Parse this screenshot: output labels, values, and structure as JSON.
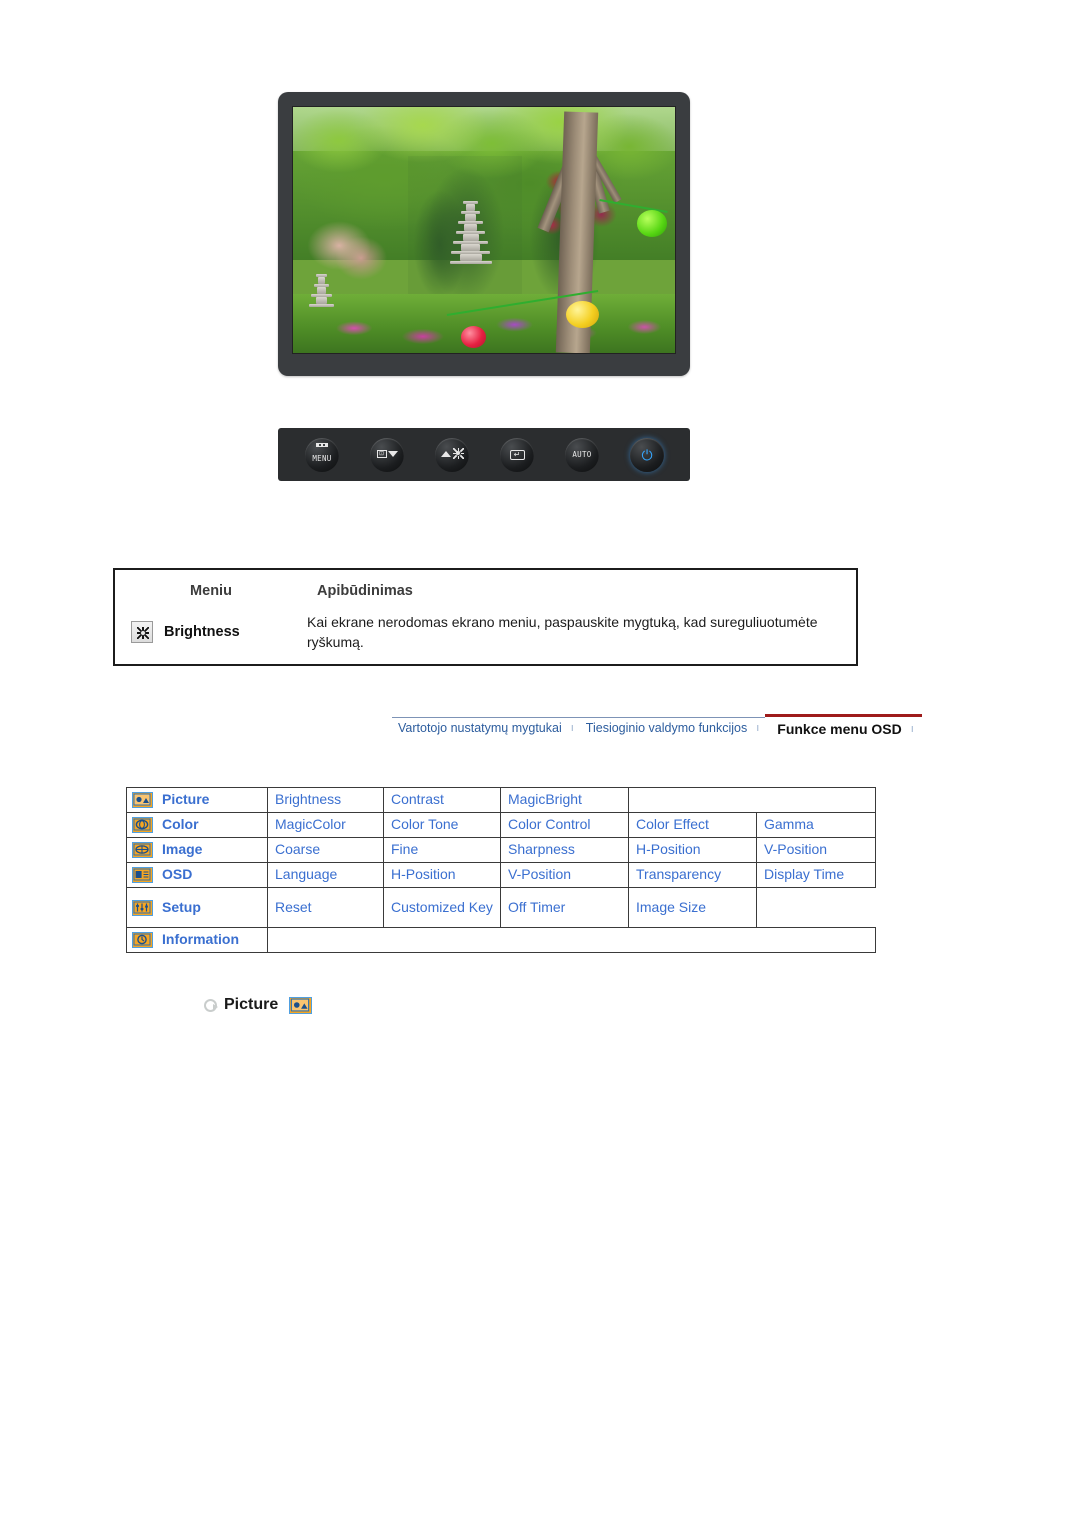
{
  "monitor": {
    "screen_alt": "garden-photo-with-stone-pagoda-and-lanterns",
    "buttons": [
      {
        "name": "menu-button",
        "label": "MENU"
      },
      {
        "name": "source-down-button",
        "label": ""
      },
      {
        "name": "brightness-up-button",
        "label": ""
      },
      {
        "name": "enter-button",
        "label": ""
      },
      {
        "name": "auto-button",
        "label": "AUTO"
      },
      {
        "name": "power-button",
        "label": ""
      }
    ]
  },
  "desc_table": {
    "headers": {
      "menu": "Meniu",
      "description": "Apibūdinimas"
    },
    "row": {
      "icon": "brightness-sun-icon",
      "label": "Brightness",
      "text": "Kai ekrane nerodomas ekrano meniu, paspauskite mygtuką, kad sureguliuotumėte ryškumą."
    }
  },
  "tabs": [
    {
      "label": "Vartotojo nustatymų mygtukai",
      "active": false
    },
    {
      "label": "Tiesioginio valdymo funkcijos",
      "active": false
    },
    {
      "label": "Funkce menu OSD",
      "active": true
    }
  ],
  "tab_separator": "ı",
  "osd_matrix": {
    "rows": [
      {
        "icon": "picture-icon",
        "category": "Picture",
        "items": [
          "Brightness",
          "Contrast",
          "MagicBright"
        ]
      },
      {
        "icon": "color-icon",
        "category": "Color",
        "items": [
          "MagicColor",
          "Color Tone",
          "Color Control",
          "Color Effect",
          "Gamma"
        ]
      },
      {
        "icon": "image-icon",
        "category": "Image",
        "items": [
          "Coarse",
          "Fine",
          "Sharpness",
          "H-Position",
          "V-Position"
        ]
      },
      {
        "icon": "osd-icon",
        "category": "OSD",
        "items": [
          "Language",
          "H-Position",
          "V-Position",
          "Transparency",
          "Display Time"
        ]
      },
      {
        "icon": "setup-icon",
        "category": "Setup",
        "items": [
          "Reset",
          "Customized Key",
          "Off Timer",
          "Image Size"
        ]
      },
      {
        "icon": "information-icon",
        "category": "Information",
        "items": []
      }
    ]
  },
  "picture_heading": {
    "bullet": "circle-arrow-bullet",
    "label": "Picture",
    "icon": "picture-icon"
  },
  "colors": {
    "link_blue": "#3a6fd0",
    "tab_blue": "#2d5d9e",
    "active_tab_rule": "#9e1b1b",
    "icon_orange": "#f5a623",
    "icon_border_blue": "#4f9fe0",
    "bezel": "#3a3d40"
  }
}
